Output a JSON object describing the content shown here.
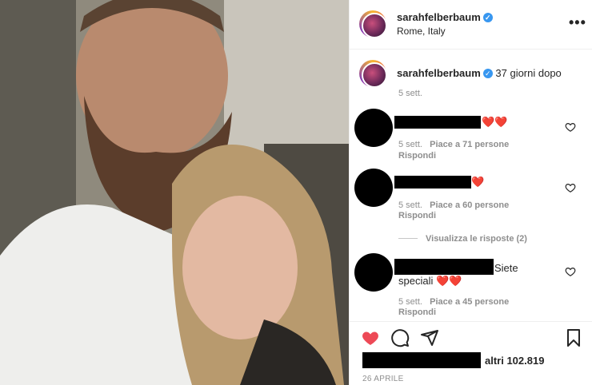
{
  "post": {
    "username": "sarahfelberbaum",
    "verified_icon": "verified-badge-icon",
    "location": "Rome, Italy",
    "more_icon": "more-options-icon",
    "more_glyph": "•••"
  },
  "caption": {
    "username": "sarahfelberbaum",
    "text": "37 giorni dopo",
    "time": "5 sett."
  },
  "comments": [
    {
      "text_suffix": "❤️❤️",
      "time": "5 sett.",
      "likes": "Piace a 71 persone",
      "reply": "Rispondi"
    },
    {
      "text_suffix": "❤️",
      "time": "5 sett.",
      "likes": "Piace a 60 persone",
      "reply": "Rispondi"
    },
    {
      "text_suffix": "Siete",
      "text_line2": "speciali ❤️❤️",
      "time": "5 sett.",
      "likes": "Piace a 45 persone",
      "reply": "Rispondi"
    }
  ],
  "view_replies": "Visualizza le risposte (2)",
  "actions": {
    "like_icon": "heart-filled-icon",
    "comment_icon": "comment-icon",
    "share_icon": "share-icon",
    "save_icon": "bookmark-icon"
  },
  "likes_text": "altri 102.819",
  "date": "26 APRILE",
  "colors": {
    "like": "#ed4956",
    "verified": "#3897f0",
    "meta": "#8e8e8e"
  }
}
